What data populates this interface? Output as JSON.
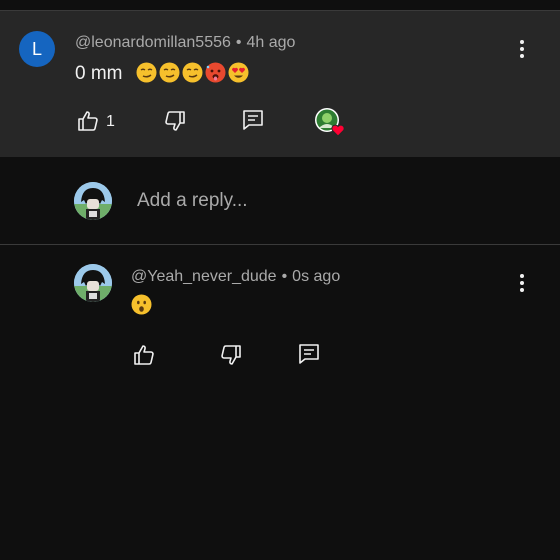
{
  "parent_comment": {
    "avatar_letter": "L",
    "author": "@leonardomillan5556",
    "separator": "•",
    "time": "4h ago",
    "text": "0 mm",
    "emojis": [
      "smirk-emoji",
      "smirk-emoji",
      "smirk-emoji",
      "hot-face-emoji",
      "heart-eyes-emoji"
    ],
    "like_count": "1",
    "colors": {
      "background": "#272727",
      "avatar": "#1565c0"
    }
  },
  "reply_box": {
    "placeholder": "Add a reply..."
  },
  "reply": {
    "author": "@Yeah_never_dude",
    "separator": "•",
    "time": "0s ago",
    "emojis": [
      "frowning-open-mouth-emoji"
    ]
  },
  "colors": {
    "page_background": "#0f0f0f",
    "secondary_text": "#aaaaaa",
    "heart": "#ff0033"
  }
}
